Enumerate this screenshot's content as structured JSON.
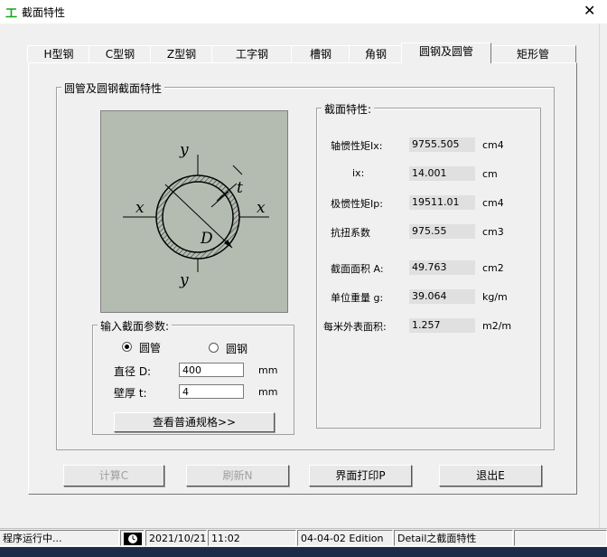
{
  "window": {
    "title": "截面特性",
    "app_icon": "工",
    "close_label": "✕"
  },
  "tabs": [
    {
      "label": "H型钢"
    },
    {
      "label": "C型钢"
    },
    {
      "label": "Z型钢"
    },
    {
      "label": "工字钢"
    },
    {
      "label": "槽钢"
    },
    {
      "label": "角钢"
    },
    {
      "label": "圆钢及圆管"
    },
    {
      "label": "矩形管"
    }
  ],
  "section_group": {
    "title": "圆管及圆钢截面特性"
  },
  "drawing": {
    "axis_x": "x",
    "axis_y": "y",
    "thickness_label": "t",
    "diameter_label": "D"
  },
  "params": {
    "title": "输入截面参数:",
    "radio_tube": "圆管",
    "radio_bar": "圆钢",
    "diameter_label": "直径 D:",
    "diameter_value": "400",
    "diameter_unit": "mm",
    "thickness_label": "壁厚 t:",
    "thickness_value": "4",
    "thickness_unit": "mm",
    "view_button": "查看普通规格>>"
  },
  "properties": {
    "title": "截面特性:",
    "rows": [
      {
        "label": "轴惯性矩Ix:",
        "value": "9755.505",
        "unit": "cm4"
      },
      {
        "label": "ix:",
        "value": "14.001",
        "unit": "cm"
      },
      {
        "label": "极惯性矩Ip:",
        "value": "19511.01",
        "unit": "cm4"
      },
      {
        "label": "抗扭系数",
        "value": "975.55",
        "unit": "cm3"
      },
      {
        "label": "截面面积 A:",
        "value": "49.763",
        "unit": "cm2"
      },
      {
        "label": "单位重量 g:",
        "value": "39.064",
        "unit": "kg/m"
      },
      {
        "label": "每米外表面积:",
        "value": "1.257",
        "unit": "m2/m"
      }
    ]
  },
  "buttons": {
    "calc": "计算C",
    "refresh": "刷新N",
    "print": "界面打印P",
    "exit": "退出E"
  },
  "status": {
    "message": "程序运行中...",
    "date": "2021/10/21",
    "time": "11:02",
    "edition": "04-04-02 Edition",
    "detail": "Detail之截面特性"
  }
}
